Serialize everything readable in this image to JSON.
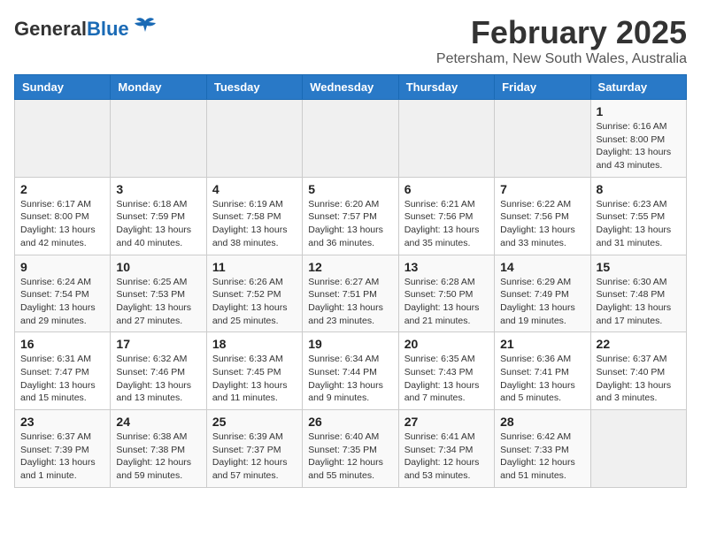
{
  "header": {
    "logo_general": "General",
    "logo_blue": "Blue",
    "month_title": "February 2025",
    "location": "Petersham, New South Wales, Australia"
  },
  "weekdays": [
    "Sunday",
    "Monday",
    "Tuesday",
    "Wednesday",
    "Thursday",
    "Friday",
    "Saturday"
  ],
  "weeks": [
    [
      {
        "day": "",
        "info": ""
      },
      {
        "day": "",
        "info": ""
      },
      {
        "day": "",
        "info": ""
      },
      {
        "day": "",
        "info": ""
      },
      {
        "day": "",
        "info": ""
      },
      {
        "day": "",
        "info": ""
      },
      {
        "day": "1",
        "info": "Sunrise: 6:16 AM\nSunset: 8:00 PM\nDaylight: 13 hours\nand 43 minutes."
      }
    ],
    [
      {
        "day": "2",
        "info": "Sunrise: 6:17 AM\nSunset: 8:00 PM\nDaylight: 13 hours\nand 42 minutes."
      },
      {
        "day": "3",
        "info": "Sunrise: 6:18 AM\nSunset: 7:59 PM\nDaylight: 13 hours\nand 40 minutes."
      },
      {
        "day": "4",
        "info": "Sunrise: 6:19 AM\nSunset: 7:58 PM\nDaylight: 13 hours\nand 38 minutes."
      },
      {
        "day": "5",
        "info": "Sunrise: 6:20 AM\nSunset: 7:57 PM\nDaylight: 13 hours\nand 36 minutes."
      },
      {
        "day": "6",
        "info": "Sunrise: 6:21 AM\nSunset: 7:56 PM\nDaylight: 13 hours\nand 35 minutes."
      },
      {
        "day": "7",
        "info": "Sunrise: 6:22 AM\nSunset: 7:56 PM\nDaylight: 13 hours\nand 33 minutes."
      },
      {
        "day": "8",
        "info": "Sunrise: 6:23 AM\nSunset: 7:55 PM\nDaylight: 13 hours\nand 31 minutes."
      }
    ],
    [
      {
        "day": "9",
        "info": "Sunrise: 6:24 AM\nSunset: 7:54 PM\nDaylight: 13 hours\nand 29 minutes."
      },
      {
        "day": "10",
        "info": "Sunrise: 6:25 AM\nSunset: 7:53 PM\nDaylight: 13 hours\nand 27 minutes."
      },
      {
        "day": "11",
        "info": "Sunrise: 6:26 AM\nSunset: 7:52 PM\nDaylight: 13 hours\nand 25 minutes."
      },
      {
        "day": "12",
        "info": "Sunrise: 6:27 AM\nSunset: 7:51 PM\nDaylight: 13 hours\nand 23 minutes."
      },
      {
        "day": "13",
        "info": "Sunrise: 6:28 AM\nSunset: 7:50 PM\nDaylight: 13 hours\nand 21 minutes."
      },
      {
        "day": "14",
        "info": "Sunrise: 6:29 AM\nSunset: 7:49 PM\nDaylight: 13 hours\nand 19 minutes."
      },
      {
        "day": "15",
        "info": "Sunrise: 6:30 AM\nSunset: 7:48 PM\nDaylight: 13 hours\nand 17 minutes."
      }
    ],
    [
      {
        "day": "16",
        "info": "Sunrise: 6:31 AM\nSunset: 7:47 PM\nDaylight: 13 hours\nand 15 minutes."
      },
      {
        "day": "17",
        "info": "Sunrise: 6:32 AM\nSunset: 7:46 PM\nDaylight: 13 hours\nand 13 minutes."
      },
      {
        "day": "18",
        "info": "Sunrise: 6:33 AM\nSunset: 7:45 PM\nDaylight: 13 hours\nand 11 minutes."
      },
      {
        "day": "19",
        "info": "Sunrise: 6:34 AM\nSunset: 7:44 PM\nDaylight: 13 hours\nand 9 minutes."
      },
      {
        "day": "20",
        "info": "Sunrise: 6:35 AM\nSunset: 7:43 PM\nDaylight: 13 hours\nand 7 minutes."
      },
      {
        "day": "21",
        "info": "Sunrise: 6:36 AM\nSunset: 7:41 PM\nDaylight: 13 hours\nand 5 minutes."
      },
      {
        "day": "22",
        "info": "Sunrise: 6:37 AM\nSunset: 7:40 PM\nDaylight: 13 hours\nand 3 minutes."
      }
    ],
    [
      {
        "day": "23",
        "info": "Sunrise: 6:37 AM\nSunset: 7:39 PM\nDaylight: 13 hours\nand 1 minute."
      },
      {
        "day": "24",
        "info": "Sunrise: 6:38 AM\nSunset: 7:38 PM\nDaylight: 12 hours\nand 59 minutes."
      },
      {
        "day": "25",
        "info": "Sunrise: 6:39 AM\nSunset: 7:37 PM\nDaylight: 12 hours\nand 57 minutes."
      },
      {
        "day": "26",
        "info": "Sunrise: 6:40 AM\nSunset: 7:35 PM\nDaylight: 12 hours\nand 55 minutes."
      },
      {
        "day": "27",
        "info": "Sunrise: 6:41 AM\nSunset: 7:34 PM\nDaylight: 12 hours\nand 53 minutes."
      },
      {
        "day": "28",
        "info": "Sunrise: 6:42 AM\nSunset: 7:33 PM\nDaylight: 12 hours\nand 51 minutes."
      },
      {
        "day": "",
        "info": ""
      }
    ]
  ]
}
